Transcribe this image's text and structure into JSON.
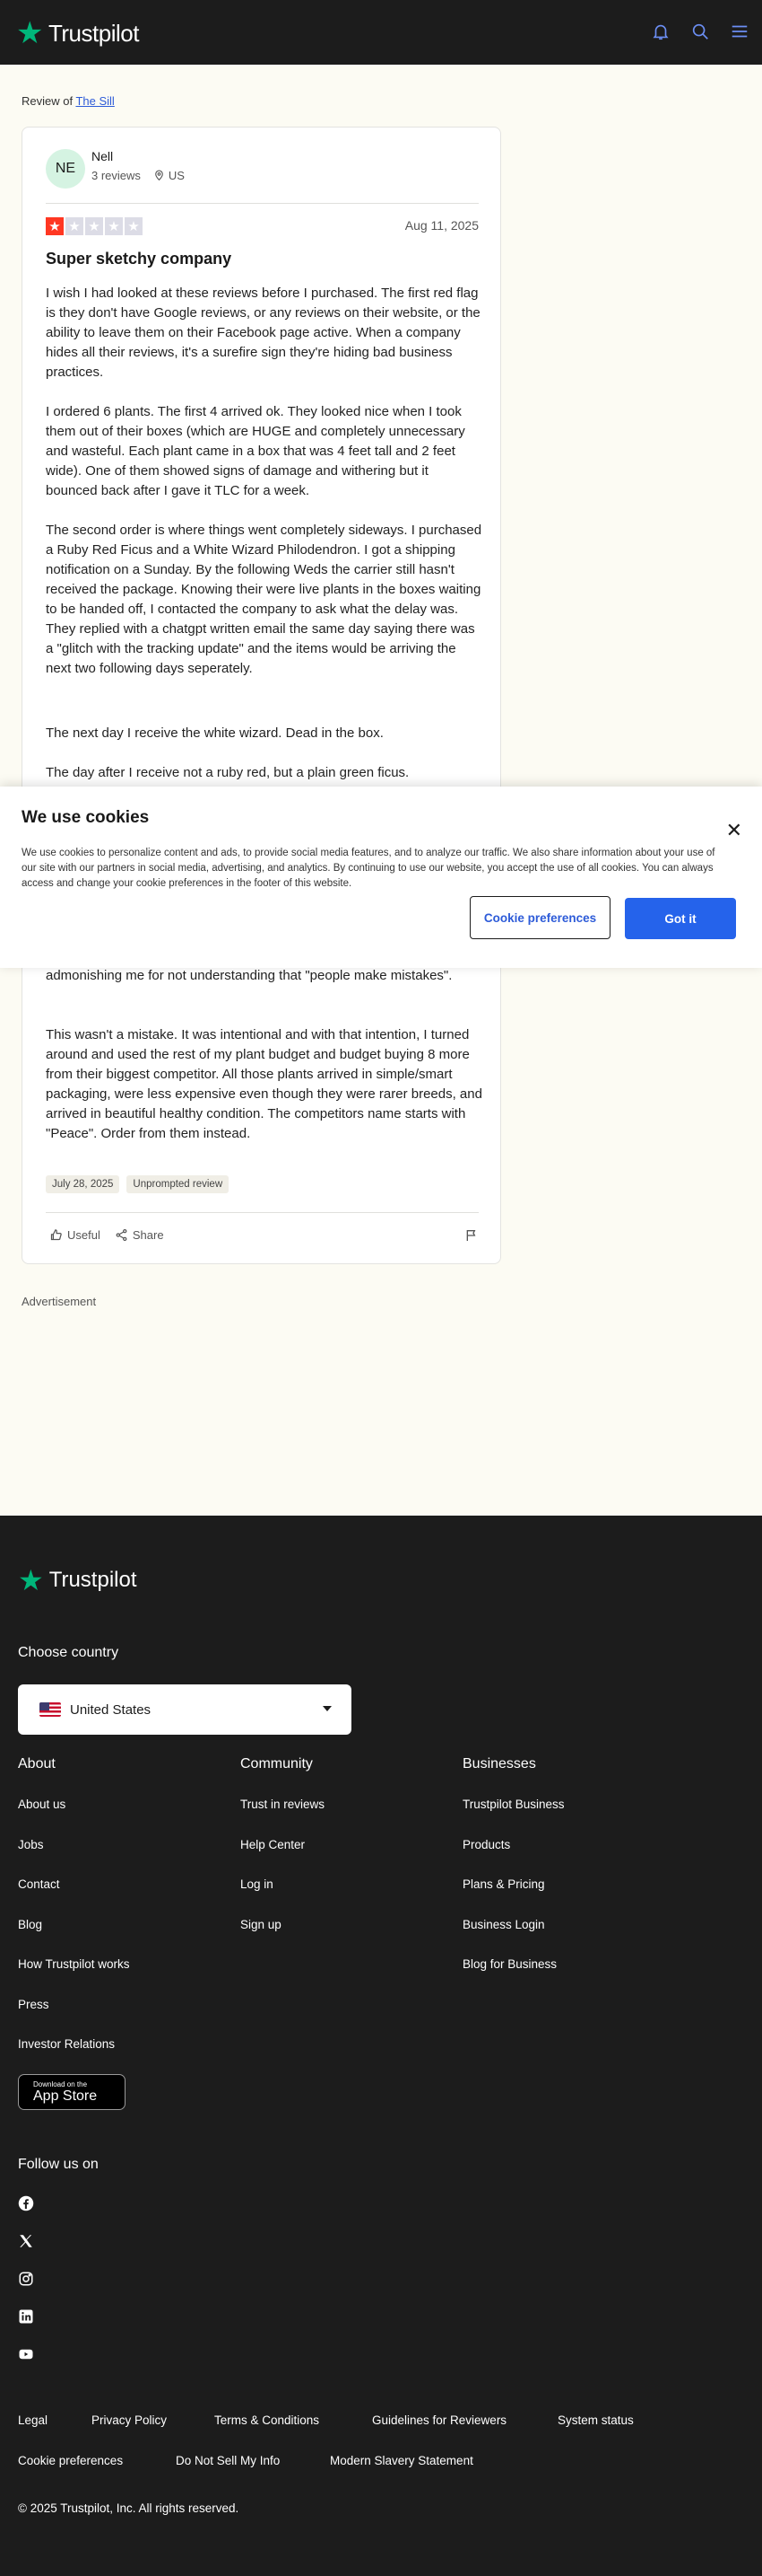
{
  "header": {
    "logo_text": "Trustpilot",
    "icons": [
      "bell-icon",
      "search-icon",
      "menu-icon"
    ]
  },
  "breadcrumb": {
    "prefix": "Review of ",
    "company": "The Sill"
  },
  "review": {
    "avatar_initials": "NE",
    "user_name": "Nell",
    "reviews_count": "3 reviews",
    "country": "US",
    "rating": 1,
    "date": "Aug 11, 2025",
    "title": "Super sketchy company",
    "paragraphs": [
      "I wish I had looked at these reviews before I purchased. The first red flag is they don't have Google reviews, or any reviews on their website, or the ability to leave them on their Facebook page active. When a company hides all their reviews, it's a surefire sign they're hiding bad business practices.",
      "I ordered 6 plants. The first 4 arrived ok. They looked nice when I took them out of their boxes (which are HUGE and completely unnecessary and wasteful. Each plant came in a box that was 4 feet tall and 2 feet wide). One of them showed signs of damage and withering but it bounced back after I gave it TLC for a week.",
      "The second order is where things went completely sideways. I purchased a Ruby Red Ficus and a White Wizard Philodendron. I got a shipping notification on a Sunday. By the following Weds the carrier still hasn't received the package. Knowing their were live plants in the boxes waiting to be handed off, I contacted the company to ask what the delay was. They replied with a chatgpt written email the same day saying there was a \"glitch with the tracking update\" and the items would be arriving the next two following days seperately.",
      "The next day I receive the white wizard. Dead in the box.",
      "The day after I receive not a ruby red, but a plain green ficus.",
      "admonishing me for not understanding that \"people make mistakes\".",
      "This wasn't a mistake. It was intentional and with that intention, I turned around and used the rest of my plant budget and budget buying 8 more from their biggest competitor. All those plants arrived in simple/smart packaging, were less expensive even though they were rarer breeds, and arrived in beautiful healthy condition. The competitors name starts with \"Peace\". Order from them instead."
    ],
    "experience_date": "July 28, 2025",
    "tag": "Unprompted review",
    "useful_label": "Useful",
    "share_label": "Share"
  },
  "advertisement_label": "Advertisement",
  "cookie_banner": {
    "title": "We use cookies",
    "text": "We use cookies to personalize content and ads, to provide social media features, and to analyze our traffic. We also share information about your use of our site with our partners in social media, advertising, and analytics. By continuing to use our website, you accept the use of all cookies. You can always access and change your cookie preferences in the footer of this website.",
    "preferences_button": "Cookie preferences",
    "accept_button": "Got it"
  },
  "footer": {
    "logo_text": "Trustpilot",
    "choose_country": "Choose country",
    "country_selected": "United States",
    "columns": [
      {
        "heading": "About",
        "links": [
          "About us",
          "Jobs",
          "Contact",
          "Blog",
          "How Trustpilot works",
          "Press",
          "Investor Relations"
        ]
      },
      {
        "heading": "Community",
        "links": [
          "Trust in reviews",
          "Help Center",
          "Log in",
          "Sign up"
        ]
      },
      {
        "heading": "Businesses",
        "links": [
          "Trustpilot Business",
          "Products",
          "Plans & Pricing",
          "Business Login",
          "Blog for Business"
        ]
      }
    ],
    "app_store": {
      "small": "Download on the",
      "big": "App Store"
    },
    "follow_us": "Follow us on",
    "social_icons": [
      "facebook-icon",
      "x-icon",
      "instagram-icon",
      "linkedin-icon",
      "youtube-icon"
    ],
    "bottom_links_row1": [
      "Legal",
      "Privacy Policy",
      "Terms & Conditions",
      "Guidelines for Reviewers",
      "System status"
    ],
    "bottom_links_row2": [
      "Cookie preferences",
      "Do Not Sell My Info",
      "Modern Slavery Statement"
    ],
    "copyright": "© 2025 Trustpilot, Inc. All rights reserved."
  },
  "colors": {
    "brand_green": "#00b67a",
    "rating_red": "#ff3722",
    "star_empty": "#dcdce6",
    "link_blue": "#2d5bd8",
    "accept_blue": "#2563eb",
    "dark_bg": "#1c1c1c"
  }
}
